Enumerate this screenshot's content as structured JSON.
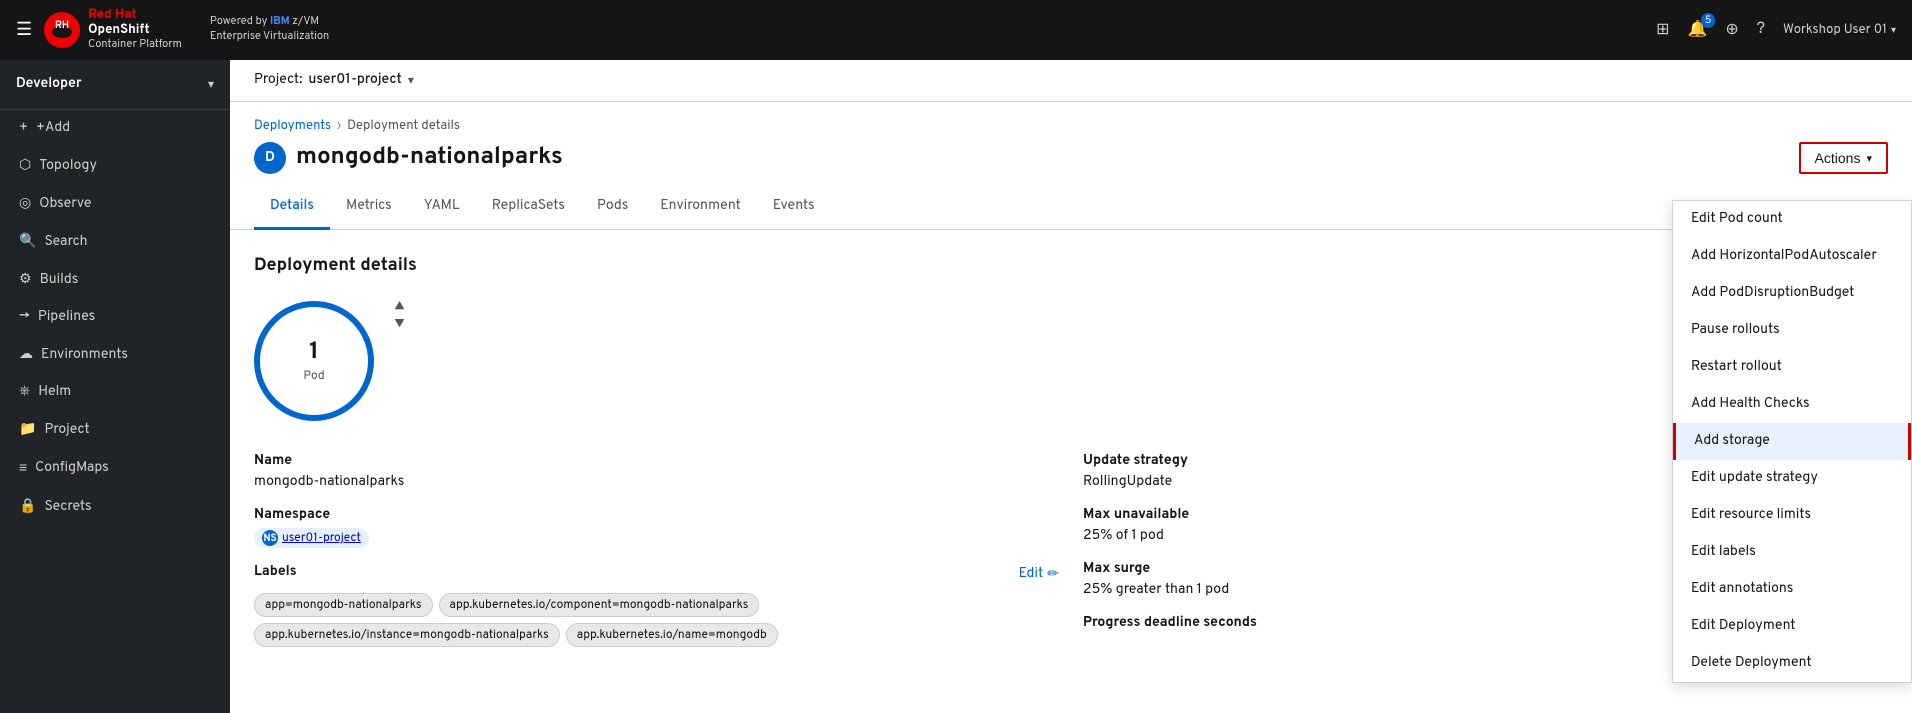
{
  "topnav": {
    "hamburger_label": "☰",
    "brand": {
      "redhat": "Red Hat",
      "openshift": "OpenShift",
      "platform": "Container Platform"
    },
    "powered_by": "Powered by",
    "ibm": "IBM",
    "zvm": "z/VM",
    "enterprise": "Enterprise Virtualization",
    "icons": {
      "grid": "⊞",
      "bell": "🔔",
      "plus": "⊕",
      "question": "?"
    },
    "notification_count": "5",
    "user": "Workshop User 01",
    "user_chevron": "▾"
  },
  "sidebar": {
    "role": "Developer",
    "items": [
      {
        "label": "+Add",
        "icon": "+"
      },
      {
        "label": "Topology",
        "icon": "⬡"
      },
      {
        "label": "Observe",
        "icon": "◎"
      },
      {
        "label": "Search",
        "icon": "🔍"
      },
      {
        "label": "Builds",
        "icon": "⚙"
      },
      {
        "label": "Pipelines",
        "icon": "→"
      },
      {
        "label": "Environments",
        "icon": "☁"
      },
      {
        "label": "Helm",
        "icon": "⎈"
      },
      {
        "label": "Project",
        "icon": "📁"
      },
      {
        "label": "ConfigMaps",
        "icon": "≡"
      },
      {
        "label": "Secrets",
        "icon": "🔒"
      }
    ]
  },
  "project_bar": {
    "label": "Project:",
    "name": "user01-project"
  },
  "breadcrumb": {
    "parent": "Deployments",
    "current": "Deployment details"
  },
  "page": {
    "title": "mongodb-nationalparks",
    "icon_letter": "D",
    "actions_label": "Actions",
    "actions_chevron": "▾"
  },
  "tabs": [
    {
      "label": "Details",
      "active": true
    },
    {
      "label": "Metrics",
      "active": false
    },
    {
      "label": "YAML",
      "active": false
    },
    {
      "label": "ReplicaSets",
      "active": false
    },
    {
      "label": "Pods",
      "active": false
    },
    {
      "label": "Environment",
      "active": false
    },
    {
      "label": "Events",
      "active": false
    }
  ],
  "content": {
    "section_title": "Deployment details",
    "pod": {
      "count": "1",
      "label": "Pod",
      "up_arrow": "▲",
      "down_arrow": "▼"
    },
    "left_details": {
      "name_label": "Name",
      "name_value": "mongodb-nationalparks",
      "namespace_label": "Namespace",
      "namespace_badge": "NS",
      "namespace_value": "user01-project",
      "labels_label": "Labels",
      "edit_label": "Edit",
      "edit_icon": "✏",
      "label_tags": [
        "app=mongodb-nationalparks",
        "app.kubernetes.io/component=mongodb-nationalparks",
        "app.kubernetes.io/instance=mongodb-nationalparks",
        "app.kubernetes.io/name=mongodb"
      ]
    },
    "right_details": {
      "update_strategy_label": "Update strategy",
      "update_strategy_value": "RollingUpdate",
      "max_unavailable_label": "Max unavailable",
      "max_unavailable_value": "25% of 1 pod",
      "max_surge_label": "Max surge",
      "max_surge_value": "25% greater than 1 pod",
      "progress_deadline_label": "Progress deadline seconds"
    }
  },
  "dropdown": {
    "items": [
      {
        "label": "Edit Pod count",
        "highlighted": false
      },
      {
        "label": "Add HorizontalPodAutoscaler",
        "highlighted": false
      },
      {
        "label": "Add PodDisruptionBudget",
        "highlighted": false
      },
      {
        "label": "Pause rollouts",
        "highlighted": false
      },
      {
        "label": "Restart rollout",
        "highlighted": false
      },
      {
        "label": "Add Health Checks",
        "highlighted": false
      },
      {
        "label": "Add storage",
        "highlighted": true
      },
      {
        "label": "Edit update strategy",
        "highlighted": false
      },
      {
        "label": "Edit resource limits",
        "highlighted": false
      },
      {
        "label": "Edit labels",
        "highlighted": false
      },
      {
        "label": "Edit annotations",
        "highlighted": false
      },
      {
        "label": "Edit Deployment",
        "highlighted": false
      },
      {
        "label": "Delete Deployment",
        "highlighted": false
      }
    ]
  }
}
